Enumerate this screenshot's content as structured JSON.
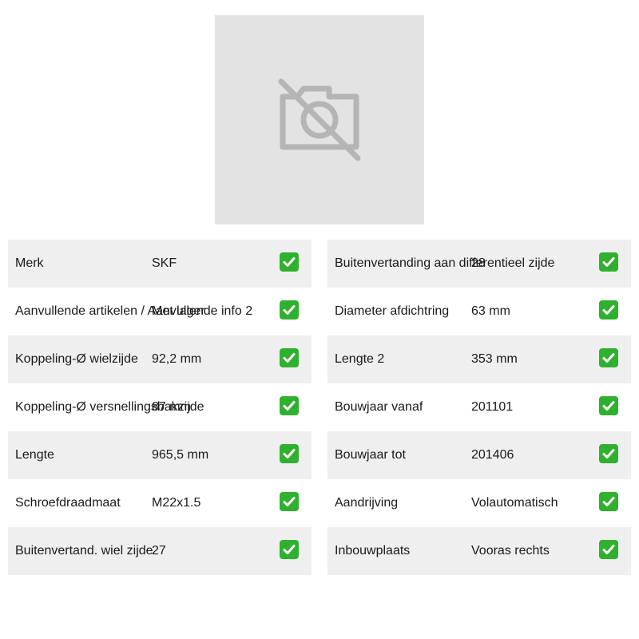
{
  "image": {
    "icon": "no-photo-icon",
    "icon_color": "#b5b5b5",
    "background": "#e3e3e3"
  },
  "check_color": "#2fb12f",
  "left_table": [
    {
      "label": "Merk",
      "value": "SKF"
    },
    {
      "label": "Aanvullende artikelen / Aanvullende info 2",
      "value": "Met lager"
    },
    {
      "label": "Koppeling-Ø wielzijde",
      "value": "92,2 mm"
    },
    {
      "label": "Koppeling-Ø versnellingsbakzijde",
      "value": "87 mm"
    },
    {
      "label": "Lengte",
      "value": "965,5 mm"
    },
    {
      "label": "Schroefdraadmaat",
      "value": "M22x1.5"
    },
    {
      "label": "Buitenvertand. wiel zijde",
      "value": "27"
    }
  ],
  "right_table": [
    {
      "label": "Buitenvertanding aan differentieel zijde",
      "value": "28"
    },
    {
      "label": "Diameter afdichtring",
      "value": "63 mm"
    },
    {
      "label": "Lengte 2",
      "value": "353 mm"
    },
    {
      "label": "Bouwjaar vanaf",
      "value": "201101"
    },
    {
      "label": "Bouwjaar tot",
      "value": "201406"
    },
    {
      "label": "Aandrijving",
      "value": "Volautomatisch"
    },
    {
      "label": "Inbouwplaats",
      "value": "Vooras rechts"
    }
  ]
}
